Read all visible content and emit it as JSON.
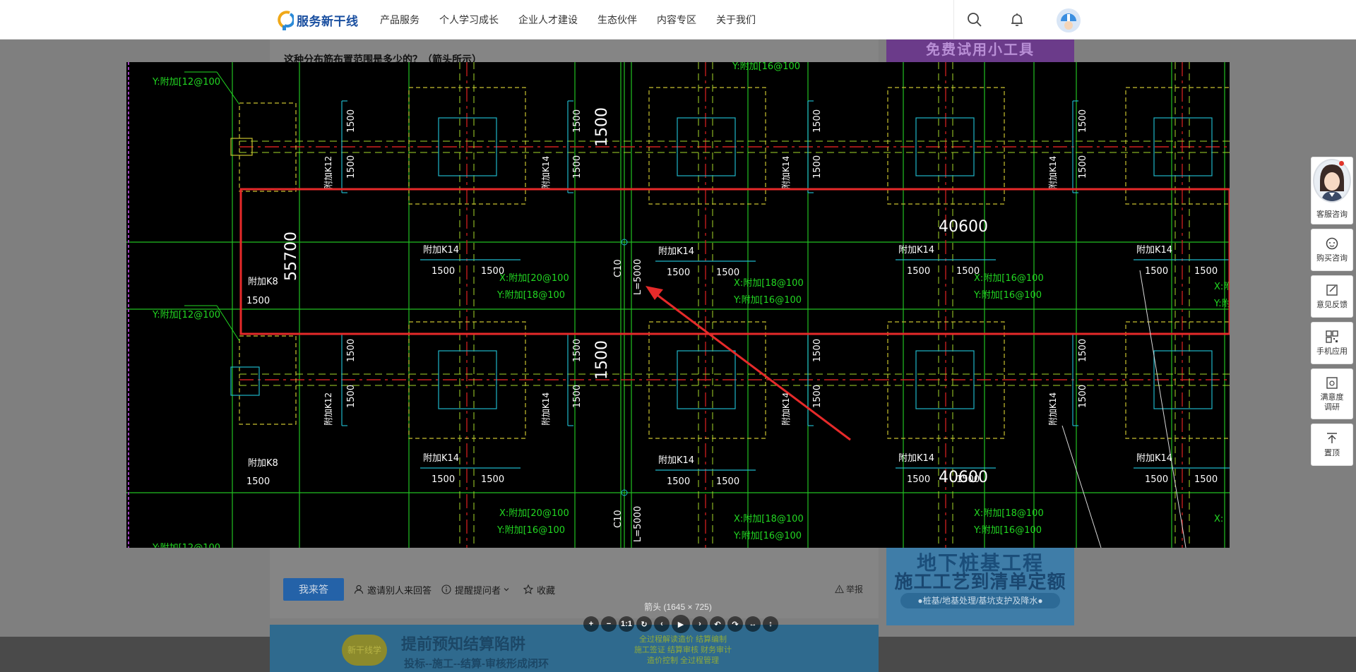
{
  "header": {
    "logo_text": "服务新干线",
    "nav": [
      "产品服务",
      "个人学习成长",
      "企业人才建设",
      "生态伙伴",
      "内容专区",
      "关于我们"
    ],
    "icons": [
      "search-icon",
      "bell-icon",
      "user-avatar"
    ]
  },
  "question": {
    "title": "这种分布筋布置范围是多少的？（箭头所示）"
  },
  "actions": {
    "answer_button": "我来答",
    "invite": "邀请别人来回答",
    "remind": "提醒提问者",
    "collect": "收藏",
    "report": "举报"
  },
  "ads": {
    "right_top": "免费试用小工具",
    "right_bottom_line1": "地下桩基工程",
    "right_bottom_line2": "施工工艺到清单定额",
    "right_bottom_line3": "●桩基/地基处理/基坑支护及降水●",
    "bottom_line1": "提前预知结算陷阱",
    "bottom_line2": "投标--施工--结算-审核形成闭环",
    "bottom_badge": "新干线学",
    "bottom_mid": [
      "全过程解读造价 结算编制",
      "施工签证 结算审核 财务审计",
      "造价控制 全过程管理"
    ]
  },
  "side_tools": [
    {
      "label": "客服咨询",
      "icon": "customer-service-avatar"
    },
    {
      "label": "购买咨询",
      "icon": "chat-icon"
    },
    {
      "label": "意见反馈",
      "icon": "feedback-icon"
    },
    {
      "label": "手机应用",
      "icon": "qrcode-icon"
    },
    {
      "label": "满意度\n调研",
      "icon": "survey-icon"
    },
    {
      "label": "置顶",
      "icon": "back-to-top-icon"
    }
  ],
  "viewer": {
    "caption": "箭头 (1645 × 725)",
    "tools": [
      "zoom-in",
      "zoom-out",
      "1:1",
      "reset",
      "prev",
      "play",
      "next",
      "rotate-left",
      "rotate-right",
      "flip-horizontal",
      "flip-vertical"
    ],
    "one_to_one": "1:1"
  },
  "drawing": {
    "dims": [
      "1500",
      "40600",
      "55700",
      "C10",
      "L=5000"
    ],
    "labels": [
      "Y:附加[12@100",
      "Y:附加[16@100",
      "附加K12",
      "附加K14",
      "附加K8",
      "X:附加[20@100",
      "Y:附加[18@100",
      "X:附加[18@100",
      "Y:附加[16@100",
      "X:附加[16@100"
    ],
    "colors": {
      "background": "#000000",
      "grid": "#22c022",
      "column": "#1fb6c9",
      "dashed": "#c8c030",
      "axis": "#d02020",
      "text": "#ffffff",
      "annotation": "#e62a2a"
    }
  }
}
